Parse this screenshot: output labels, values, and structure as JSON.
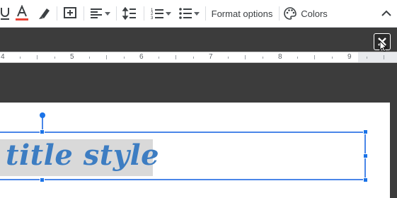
{
  "toolbar": {
    "format_options_label": "Format options",
    "colors_label": "Colors",
    "text_color_accent": "#ea4335"
  },
  "ruler": {
    "numbers": [
      "4",
      "5",
      "6",
      "7",
      "8",
      "9"
    ]
  },
  "slide": {
    "title_text": "title style"
  },
  "colors": {
    "title_color": "#3d7dc2",
    "selection_color": "#4a86e8",
    "dark_background": "#3c3c3c"
  }
}
